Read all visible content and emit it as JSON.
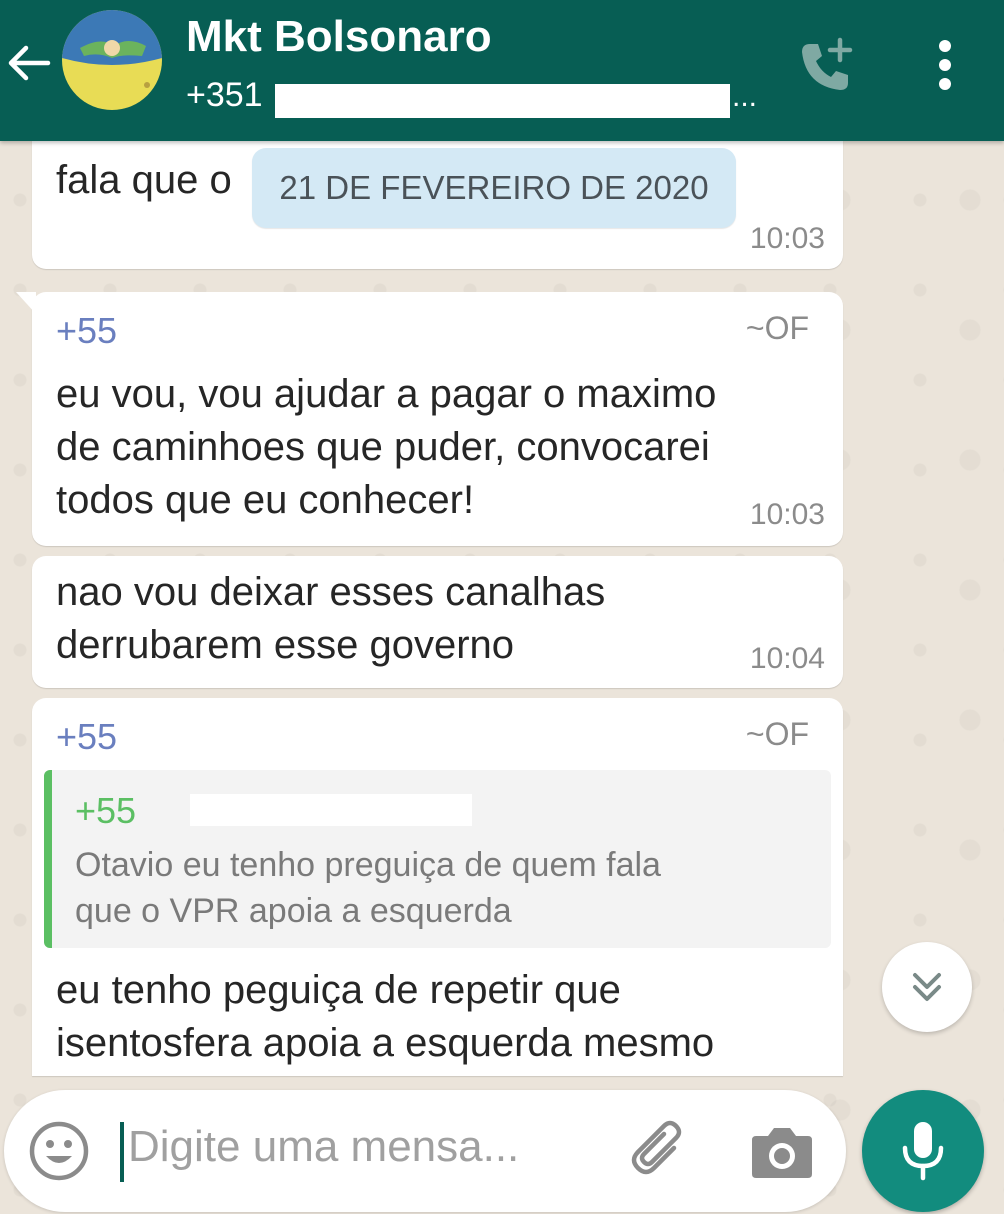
{
  "header": {
    "title": "Mkt Bolsonaro",
    "subtitle_prefix": "+351",
    "subtitle_suffix": "..."
  },
  "colors": {
    "header": "#075e54",
    "mic": "#128c7e",
    "quote_accent": "#5bbf63"
  },
  "date_chip": "21 DE FEVEREIRO DE 2020",
  "messages": [
    {
      "text": "fala que o",
      "time": "10:03"
    },
    {
      "sender": "+55",
      "handle": "~OF",
      "text_lines": [
        "eu vou, vou ajudar a pagar o maximo",
        "de caminhoes que puder, convocarei",
        "todos que eu conhecer!"
      ],
      "time": "10:03"
    },
    {
      "text_lines": [
        "nao vou deixar esses canalhas",
        "derrubarem esse governo"
      ],
      "time": "10:04"
    },
    {
      "sender": "+55",
      "handle": "~OF",
      "quote": {
        "sender": "+55",
        "text_lines": [
          "Otavio eu tenho preguiça de quem fala",
          "que o VPR apoia a esquerda"
        ]
      },
      "text_lines": [
        "eu tenho peguiça de repetir que",
        "isentosfera apoia a esquerda mesmo"
      ]
    }
  ],
  "input": {
    "placeholder": "Digite uma mensa..."
  },
  "icons": [
    "back-arrow-icon",
    "add-call-icon",
    "more-options-icon",
    "chevron-double-down-icon",
    "emoji-icon",
    "attach-icon",
    "camera-icon",
    "microphone-icon"
  ]
}
